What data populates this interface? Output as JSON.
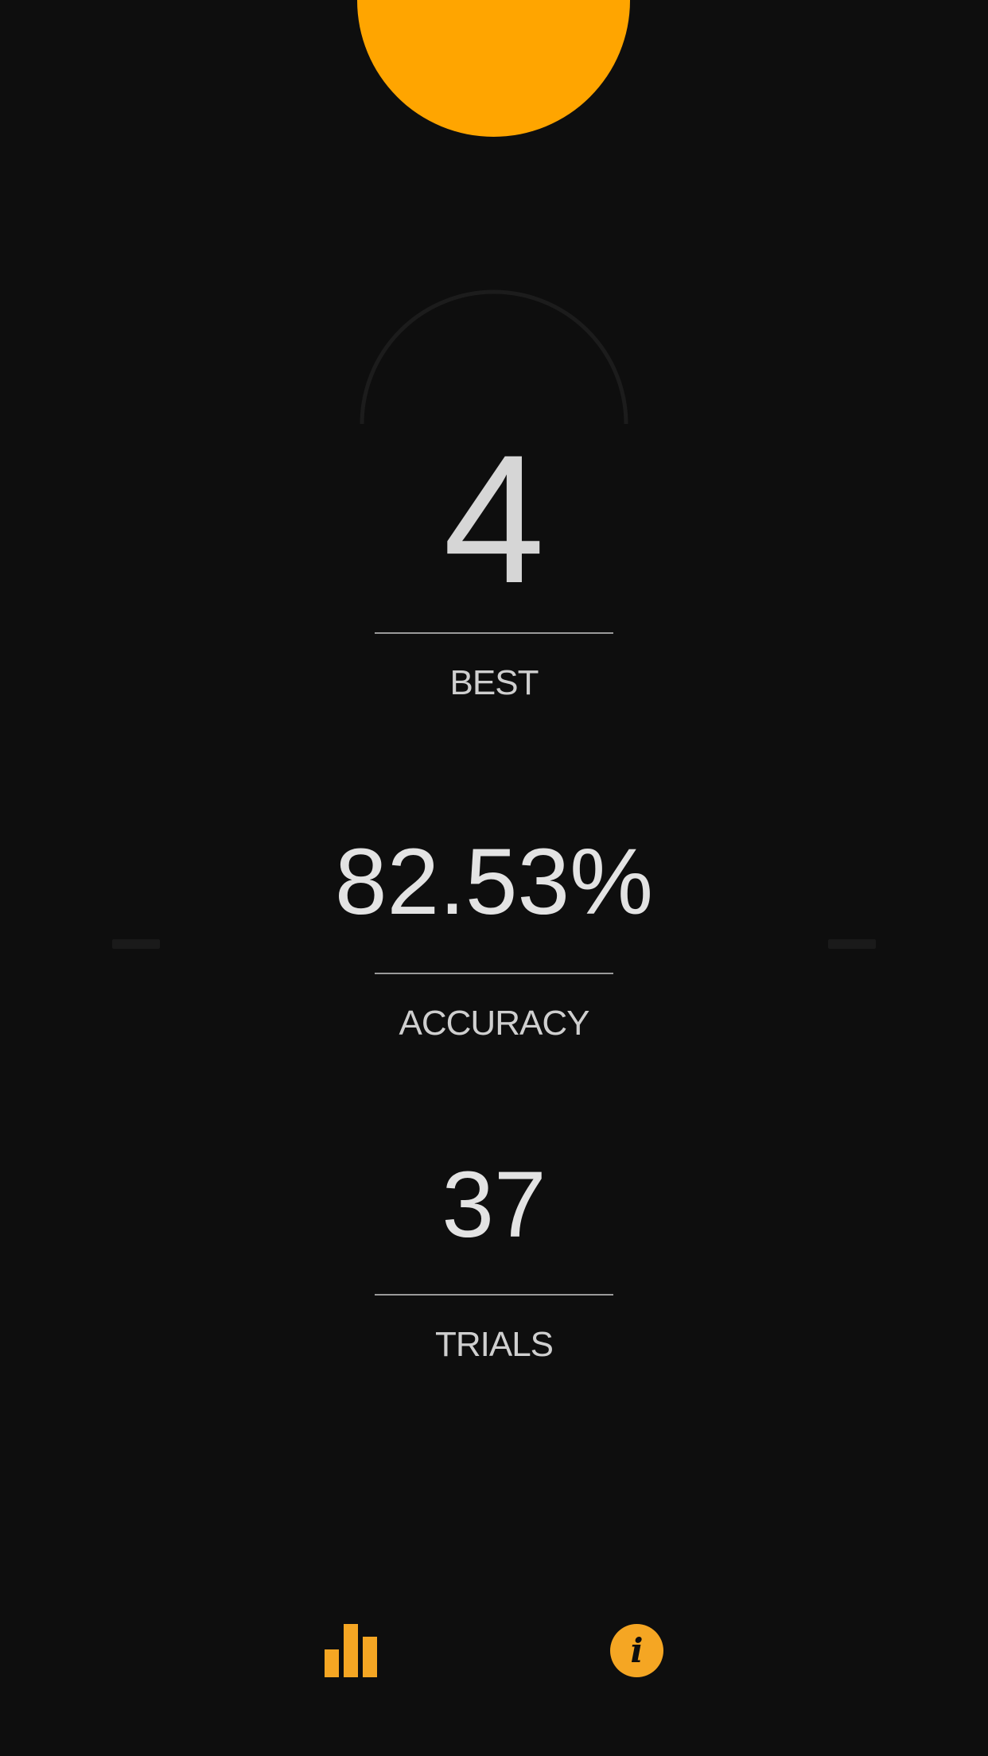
{
  "colors": {
    "background": "#0e0e0e",
    "accent": "#ffa500",
    "icon_accent": "#f5a623",
    "ghost_arc": "#1c1c1c"
  },
  "stats": {
    "best": {
      "value": "4",
      "label": "BEST"
    },
    "accuracy": {
      "value": "82.53%",
      "label": "ACCURACY"
    },
    "trials": {
      "value": "37",
      "label": "TRIALS"
    }
  },
  "bottom_bar": {
    "stats_icon": "bar-chart-icon",
    "info_icon": "info-icon",
    "info_glyph": "i"
  }
}
